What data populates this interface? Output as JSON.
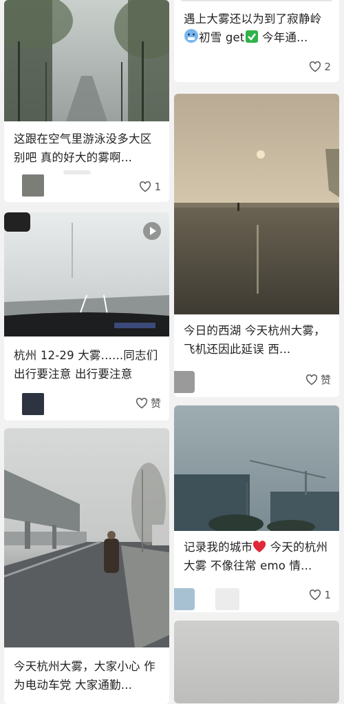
{
  "feed": {
    "left": [
      {
        "title": "这跟在空气里游泳没多大区别吧 真的好大的雾啊...",
        "likes": "1",
        "has_video": false
      },
      {
        "title": "杭州 12-29 大雾......同志们 出行要注意 出行要注意",
        "likes": "赞",
        "has_video": true
      },
      {
        "title": "今天杭州大雾，大家小心 作为电动车党 大家通勤...",
        "likes": "",
        "has_video": false
      }
    ],
    "right": [
      {
        "title_part1": "遇上大雾还以为到了寂静岭",
        "title_part2": "初雪 get",
        "title_part3": " 今年通...",
        "likes": "2"
      },
      {
        "title": "今日的西湖 今天杭州大雾，飞机还因此延误 西...",
        "likes": "赞"
      },
      {
        "title_part1": "记录我的城市",
        "title_part2": " 今天的杭州大雾 不像往常 emo 情...",
        "likes": "1"
      },
      {
        "title": "",
        "likes": ""
      }
    ]
  },
  "icons": {
    "heart": "heart-outline-icon",
    "play": "play-icon",
    "cold_face": "cold-face-emoji",
    "check": "check-mark-emoji",
    "red_heart": "red-heart-emoji"
  },
  "colors": {
    "background": "#f2f2f2",
    "card": "#ffffff",
    "text": "#222222",
    "check_green": "#2fb34a",
    "heart_red": "#e0283a"
  }
}
